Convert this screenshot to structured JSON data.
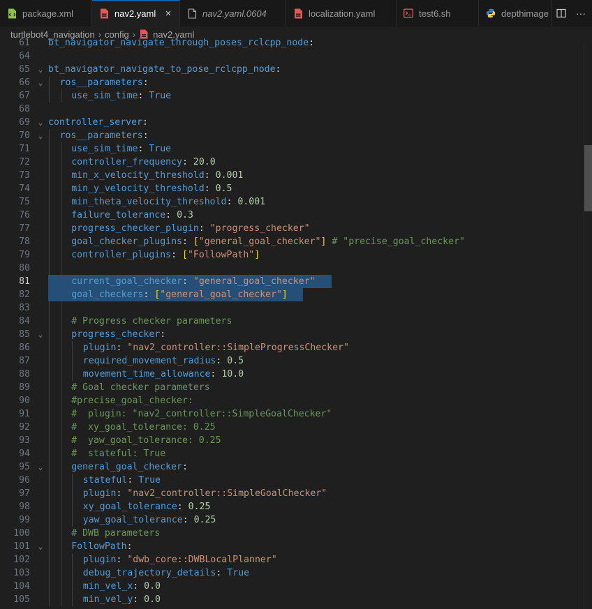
{
  "tabs": [
    {
      "label": "package.xml",
      "icon": "xml-file-icon",
      "active": false,
      "italic": false
    },
    {
      "label": "nav2.yaml",
      "icon": "yaml-file-icon",
      "active": true,
      "italic": false,
      "close": "×"
    },
    {
      "label": "nav2.yaml.0604",
      "icon": "file-icon",
      "active": false,
      "italic": true
    },
    {
      "label": "localization.yaml",
      "icon": "yaml-file-icon",
      "active": false,
      "italic": false
    },
    {
      "label": "test6.sh",
      "icon": "terminal-file-icon",
      "active": false,
      "italic": false
    },
    {
      "label": "depthimage",
      "icon": "python-file-icon",
      "active": false,
      "italic": false
    }
  ],
  "tab_actions": [
    {
      "icon": "split-editor-icon"
    },
    {
      "icon": "more-actions-icon",
      "glyph": "···"
    }
  ],
  "breadcrumb": {
    "items": [
      "turtlebot4_navigation",
      "config",
      "nav2.yaml"
    ],
    "separator": "›"
  },
  "editor": {
    "cursor_line": "81",
    "lines": [
      {
        "num": "61",
        "indent": 0,
        "fold": false,
        "tokens": [
          {
            "t": "bt_navigator_navigate_through_poses_rclcpp_node",
            "c": "k"
          },
          {
            "t": ":",
            "c": "p"
          }
        ]
      },
      {
        "num": "64",
        "indent": 0,
        "fold": false,
        "tokens": []
      },
      {
        "num": "65",
        "indent": 0,
        "fold": true,
        "tokens": [
          {
            "t": "bt_navigator_navigate_to_pose_rclcpp_node",
            "c": "k"
          },
          {
            "t": ":",
            "c": "p"
          }
        ]
      },
      {
        "num": "66",
        "indent": 1,
        "fold": true,
        "tokens": [
          {
            "t": "ros__parameters",
            "c": "k"
          },
          {
            "t": ":",
            "c": "p"
          }
        ]
      },
      {
        "num": "67",
        "indent": 2,
        "fold": false,
        "tokens": [
          {
            "t": "use_sim_time",
            "c": "k"
          },
          {
            "t": ": ",
            "c": "p"
          },
          {
            "t": "True",
            "c": "b"
          }
        ]
      },
      {
        "num": "68",
        "indent": 0,
        "fold": false,
        "tokens": []
      },
      {
        "num": "69",
        "indent": 0,
        "fold": true,
        "tokens": [
          {
            "t": "controller_server",
            "c": "k"
          },
          {
            "t": ":",
            "c": "p"
          }
        ]
      },
      {
        "num": "70",
        "indent": 1,
        "fold": true,
        "tokens": [
          {
            "t": "ros__parameters",
            "c": "k"
          },
          {
            "t": ":",
            "c": "p"
          }
        ]
      },
      {
        "num": "71",
        "indent": 2,
        "fold": false,
        "tokens": [
          {
            "t": "use_sim_time",
            "c": "k"
          },
          {
            "t": ": ",
            "c": "p"
          },
          {
            "t": "True",
            "c": "b"
          }
        ]
      },
      {
        "num": "72",
        "indent": 2,
        "fold": false,
        "tokens": [
          {
            "t": "controller_frequency",
            "c": "k"
          },
          {
            "t": ": ",
            "c": "p"
          },
          {
            "t": "20.0",
            "c": "n"
          }
        ]
      },
      {
        "num": "73",
        "indent": 2,
        "fold": false,
        "tokens": [
          {
            "t": "min_x_velocity_threshold",
            "c": "k"
          },
          {
            "t": ": ",
            "c": "p"
          },
          {
            "t": "0.001",
            "c": "n"
          }
        ]
      },
      {
        "num": "74",
        "indent": 2,
        "fold": false,
        "tokens": [
          {
            "t": "min_y_velocity_threshold",
            "c": "k"
          },
          {
            "t": ": ",
            "c": "p"
          },
          {
            "t": "0.5",
            "c": "n"
          }
        ]
      },
      {
        "num": "75",
        "indent": 2,
        "fold": false,
        "tokens": [
          {
            "t": "min_theta_velocity_threshold",
            "c": "k"
          },
          {
            "t": ": ",
            "c": "p"
          },
          {
            "t": "0.001",
            "c": "n"
          }
        ]
      },
      {
        "num": "76",
        "indent": 2,
        "fold": false,
        "tokens": [
          {
            "t": "failure_tolerance",
            "c": "k"
          },
          {
            "t": ": ",
            "c": "p"
          },
          {
            "t": "0.3",
            "c": "n"
          }
        ]
      },
      {
        "num": "77",
        "indent": 2,
        "fold": false,
        "tokens": [
          {
            "t": "progress_checker_plugin",
            "c": "k"
          },
          {
            "t": ": ",
            "c": "p"
          },
          {
            "t": "\"progress_checker\"",
            "c": "s"
          }
        ]
      },
      {
        "num": "78",
        "indent": 2,
        "fold": false,
        "tokens": [
          {
            "t": "goal_checker_plugins",
            "c": "k"
          },
          {
            "t": ": ",
            "c": "p"
          },
          {
            "t": "[",
            "c": "br"
          },
          {
            "t": "\"general_goal_checker\"",
            "c": "s"
          },
          {
            "t": "]",
            "c": "br"
          },
          {
            "t": " # \"precise_goal_checker\"",
            "c": "c"
          }
        ]
      },
      {
        "num": "79",
        "indent": 2,
        "fold": false,
        "tokens": [
          {
            "t": "controller_plugins",
            "c": "k"
          },
          {
            "t": ": ",
            "c": "p"
          },
          {
            "t": "[",
            "c": "br"
          },
          {
            "t": "\"FollowPath\"",
            "c": "s"
          },
          {
            "t": "]",
            "c": "br"
          }
        ]
      },
      {
        "num": "80",
        "indent": 2,
        "fold": false,
        "tokens": []
      },
      {
        "num": "81",
        "indent": 2,
        "fold": false,
        "selected": true,
        "tokens": [
          {
            "t": "current_goal_checker",
            "c": "k"
          },
          {
            "t": ": ",
            "c": "p"
          },
          {
            "t": "\"general_goal_checker\"",
            "c": "s"
          }
        ]
      },
      {
        "num": "82",
        "indent": 2,
        "fold": false,
        "selected": true,
        "tokens": [
          {
            "t": "goal_checkers",
            "c": "k"
          },
          {
            "t": ": ",
            "c": "p"
          },
          {
            "t": "[",
            "c": "br"
          },
          {
            "t": "\"general_goal_checker\"",
            "c": "s"
          },
          {
            "t": "]",
            "c": "br"
          }
        ]
      },
      {
        "num": "83",
        "indent": 2,
        "fold": false,
        "tokens": []
      },
      {
        "num": "84",
        "indent": 2,
        "fold": false,
        "tokens": [
          {
            "t": "# Progress checker parameters",
            "c": "c"
          }
        ]
      },
      {
        "num": "85",
        "indent": 2,
        "fold": true,
        "tokens": [
          {
            "t": "progress_checker",
            "c": "k"
          },
          {
            "t": ":",
            "c": "p"
          }
        ]
      },
      {
        "num": "86",
        "indent": 3,
        "fold": false,
        "tokens": [
          {
            "t": "plugin",
            "c": "k"
          },
          {
            "t": ": ",
            "c": "p"
          },
          {
            "t": "\"nav2_controller::SimpleProgressChecker\"",
            "c": "s"
          }
        ]
      },
      {
        "num": "87",
        "indent": 3,
        "fold": false,
        "tokens": [
          {
            "t": "required_movement_radius",
            "c": "k"
          },
          {
            "t": ": ",
            "c": "p"
          },
          {
            "t": "0.5",
            "c": "n"
          }
        ]
      },
      {
        "num": "88",
        "indent": 3,
        "fold": false,
        "tokens": [
          {
            "t": "movement_time_allowance",
            "c": "k"
          },
          {
            "t": ": ",
            "c": "p"
          },
          {
            "t": "10.0",
            "c": "n"
          }
        ]
      },
      {
        "num": "89",
        "indent": 2,
        "fold": false,
        "tokens": [
          {
            "t": "# Goal checker parameters",
            "c": "c"
          }
        ]
      },
      {
        "num": "90",
        "indent": 2,
        "fold": false,
        "tokens": [
          {
            "t": "#precise_goal_checker:",
            "c": "c"
          }
        ]
      },
      {
        "num": "91",
        "indent": 2,
        "fold": false,
        "tokens": [
          {
            "t": "#  plugin: \"nav2_controller::SimpleGoalChecker\"",
            "c": "c"
          }
        ]
      },
      {
        "num": "92",
        "indent": 2,
        "fold": false,
        "tokens": [
          {
            "t": "#  xy_goal_tolerance: 0.25",
            "c": "c"
          }
        ]
      },
      {
        "num": "93",
        "indent": 2,
        "fold": false,
        "tokens": [
          {
            "t": "#  yaw_goal_tolerance: 0.25",
            "c": "c"
          }
        ]
      },
      {
        "num": "94",
        "indent": 2,
        "fold": false,
        "tokens": [
          {
            "t": "#  stateful: True",
            "c": "c"
          }
        ]
      },
      {
        "num": "95",
        "indent": 2,
        "fold": true,
        "tokens": [
          {
            "t": "general_goal_checker",
            "c": "k"
          },
          {
            "t": ":",
            "c": "p"
          }
        ]
      },
      {
        "num": "96",
        "indent": 3,
        "fold": false,
        "tokens": [
          {
            "t": "stateful",
            "c": "k"
          },
          {
            "t": ": ",
            "c": "p"
          },
          {
            "t": "True",
            "c": "b"
          }
        ]
      },
      {
        "num": "97",
        "indent": 3,
        "fold": false,
        "tokens": [
          {
            "t": "plugin",
            "c": "k"
          },
          {
            "t": ": ",
            "c": "p"
          },
          {
            "t": "\"nav2_controller::SimpleGoalChecker\"",
            "c": "s"
          }
        ]
      },
      {
        "num": "98",
        "indent": 3,
        "fold": false,
        "tokens": [
          {
            "t": "xy_goal_tolerance",
            "c": "k"
          },
          {
            "t": ": ",
            "c": "p"
          },
          {
            "t": "0.25",
            "c": "n"
          }
        ]
      },
      {
        "num": "99",
        "indent": 3,
        "fold": false,
        "tokens": [
          {
            "t": "yaw_goal_tolerance",
            "c": "k"
          },
          {
            "t": ": ",
            "c": "p"
          },
          {
            "t": "0.25",
            "c": "n"
          }
        ]
      },
      {
        "num": "100",
        "indent": 2,
        "fold": false,
        "tokens": [
          {
            "t": "# DWB parameters",
            "c": "c"
          }
        ]
      },
      {
        "num": "101",
        "indent": 2,
        "fold": true,
        "tokens": [
          {
            "t": "FollowPath",
            "c": "k"
          },
          {
            "t": ":",
            "c": "p"
          }
        ]
      },
      {
        "num": "102",
        "indent": 3,
        "fold": false,
        "tokens": [
          {
            "t": "plugin",
            "c": "k"
          },
          {
            "t": ": ",
            "c": "p"
          },
          {
            "t": "\"dwb_core::DWBLocalPlanner\"",
            "c": "s"
          }
        ]
      },
      {
        "num": "103",
        "indent": 3,
        "fold": false,
        "tokens": [
          {
            "t": "debug_trajectory_details",
            "c": "k"
          },
          {
            "t": ": ",
            "c": "p"
          },
          {
            "t": "True",
            "c": "b"
          }
        ]
      },
      {
        "num": "104",
        "indent": 3,
        "fold": false,
        "tokens": [
          {
            "t": "min_vel_x",
            "c": "k"
          },
          {
            "t": ": ",
            "c": "p"
          },
          {
            "t": "0.0",
            "c": "n"
          }
        ]
      },
      {
        "num": "105",
        "indent": 3,
        "fold": false,
        "tokens": [
          {
            "t": "min_vel_y",
            "c": "k"
          },
          {
            "t": ": ",
            "c": "p"
          },
          {
            "t": "0.0",
            "c": "n"
          }
        ]
      }
    ]
  },
  "colors": {
    "background": "#1f1f1f",
    "key": "#569cd6",
    "string": "#ce9178",
    "number": "#b5cea8",
    "comment": "#6a9955",
    "selection": "#264f78",
    "tab_accent": "#0078d4"
  }
}
